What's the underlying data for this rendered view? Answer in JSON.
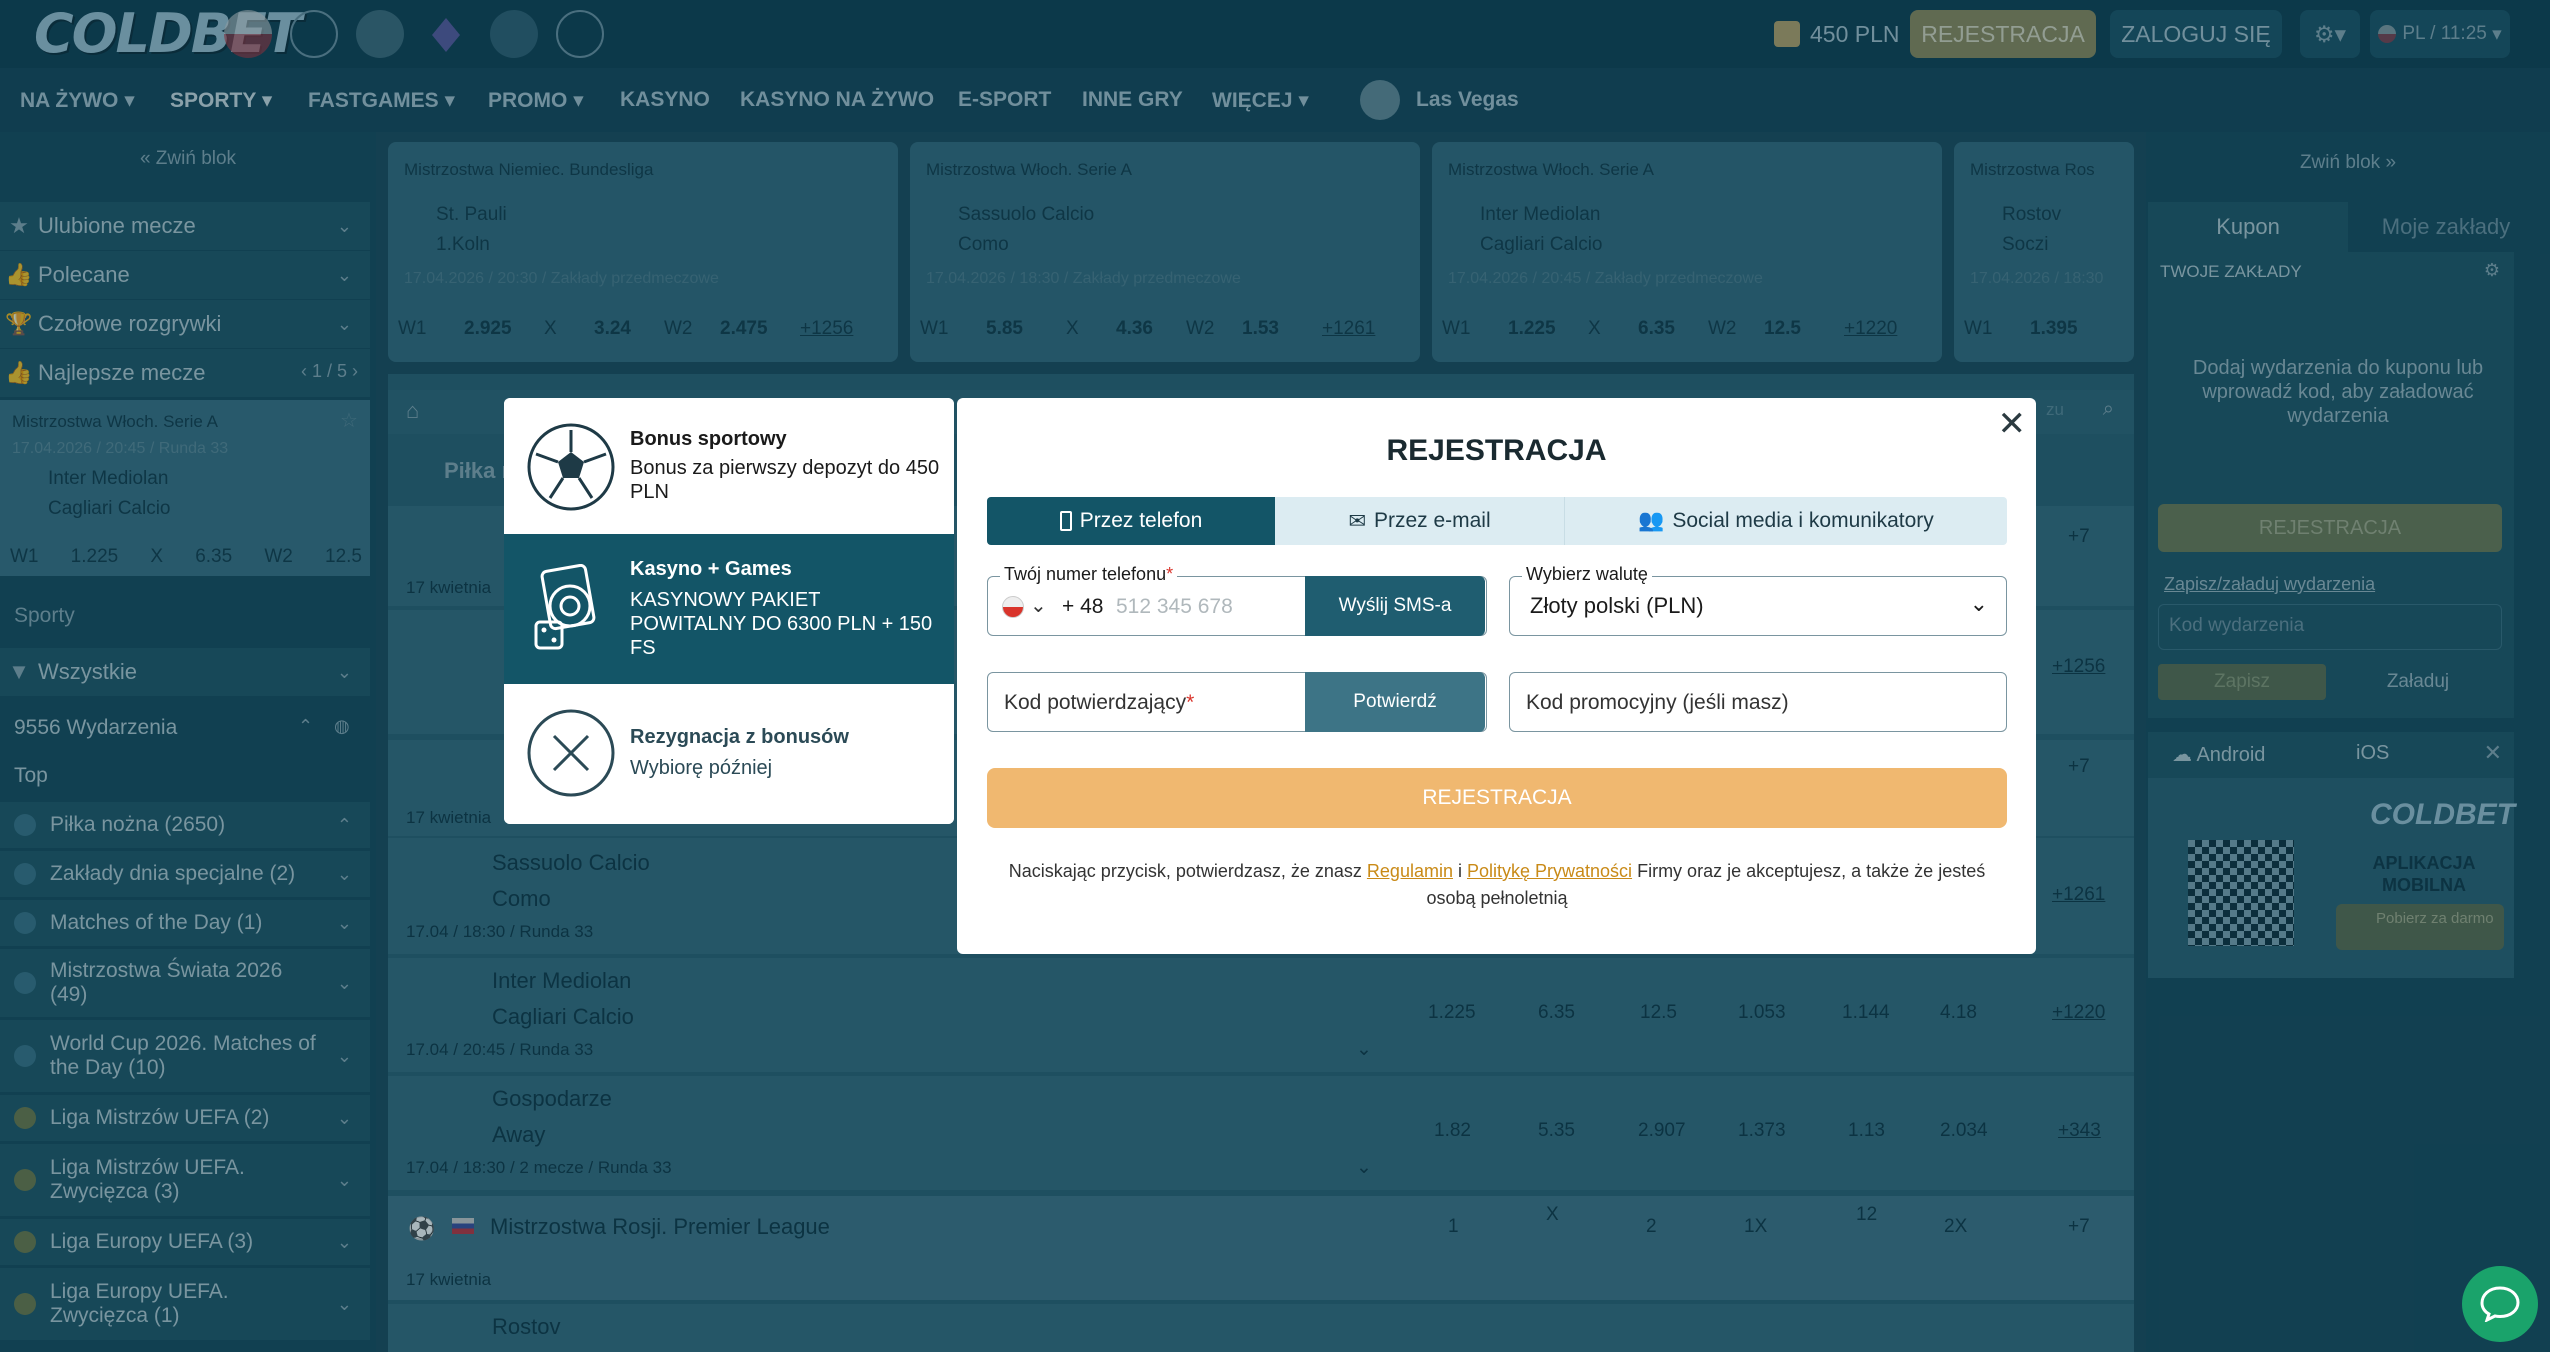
{
  "header": {
    "brand": "COLDBET",
    "balance": "450 PLN",
    "register": "REJESTRACJA",
    "login": "ZALOGUJ SIĘ",
    "lang_time": "PL / 11:25"
  },
  "nav": [
    "NA ŻYWO",
    "SPORTY",
    "FASTGAMES",
    "PROMO",
    "KASYNO",
    "KASYNO NA ŻYWO",
    "E-SPORT",
    "INNE GRY",
    "WIĘCEJ",
    "Las Vegas"
  ],
  "left": {
    "collapse": "Zwiń blok",
    "items": [
      "Ulubione mecze",
      "Polecane",
      "Czołowe rozgrywki",
      "Najlepsze mecze"
    ],
    "best_pager": "1 / 5",
    "mini": {
      "league": "Mistrzostwa Włoch. Serie A",
      "date": "17.04.2026 / 20:45 / Runda 33",
      "home": "Inter Mediolan",
      "away": "Cagliari Calcio",
      "w1": "W1",
      "o1": "1.225",
      "x": "X",
      "ox": "6.35",
      "w2": "W2",
      "o2": "12.5"
    },
    "sports_title": "Sporty",
    "filter": "Wszystkie",
    "events_count": "9556 Wydarzenia",
    "top": "Top",
    "sports": [
      "Piłka nożna (2650)",
      "Zakłady dnia specjalne (2)",
      "Matches of the Day (1)",
      "Mistrzostwa Świata 2026 (49)",
      "World Cup 2026. Matches of the Day (10)",
      "Liga Mistrzów UEFA (2)",
      "Liga Mistrzów UEFA. Zwycięzca (3)",
      "Liga Europy UEFA (3)",
      "Liga Europy UEFA. Zwycięzca (1)"
    ]
  },
  "cards": [
    {
      "league": "Mistrzostwa Niemiec. Bundesliga",
      "home": "St. Pauli",
      "away": "1.Koln",
      "date": "17.04.2026 / 20:30 / Zakłady przedmeczowe",
      "w1": "2.925",
      "x": "3.24",
      "w2": "2.475",
      "more": "+1256"
    },
    {
      "league": "Mistrzostwa Włoch. Serie A",
      "home": "Sassuolo Calcio",
      "away": "Como",
      "date": "17.04.2026 / 18:30 / Zakłady przedmeczowe",
      "w1": "5.85",
      "x": "4.36",
      "w2": "1.53",
      "more": "+1261"
    },
    {
      "league": "Mistrzostwa Włoch. Serie A",
      "home": "Inter Mediolan",
      "away": "Cagliari Calcio",
      "date": "17.04.2026 / 20:45 / Zakłady przedmeczowe",
      "w1": "1.225",
      "x": "6.35",
      "w2": "12.5",
      "more": "+1220"
    },
    {
      "league": "Mistrzostwa Ros",
      "home": "Rostov",
      "away": "Soczi",
      "date": "17.04.2026 / 18:30",
      "w1": "1.395",
      "x": "",
      "w2": "",
      "more": ""
    }
  ],
  "odd_labels": {
    "w1": "W1",
    "x": "X",
    "w2": "W2"
  },
  "center": {
    "league_head": "Piłka n",
    "day1": "17 kwietnia",
    "day2": "17 kwietnia",
    "ev1": {
      "home": "Sassuolo Calcio",
      "away": "Como",
      "date": "17.04 / 18:30 / Runda 33",
      "more": "+1261"
    },
    "ev2": {
      "home": "Inter Mediolan",
      "away": "Cagliari Calcio",
      "date": "17.04 / 20:45 / Runda 33",
      "odds": [
        "1.225",
        "6.35",
        "12.5",
        "1.053",
        "1.144",
        "4.18"
      ],
      "more": "+1220"
    },
    "ev3": {
      "home": "Gospodarze",
      "away": "Away",
      "date": "17.04 / 18:30 / 2 mecze / Runda 33",
      "odds": [
        "1.82",
        "5.35",
        "2.907",
        "1.373",
        "1.13",
        "2.034"
      ],
      "more": "+343"
    },
    "russia": {
      "league": "Mistrzostwa Rosji. Premier League",
      "cols": [
        "1",
        "X",
        "2",
        "1X",
        "12",
        "2X",
        "+7"
      ],
      "day": "17 kwietnia",
      "team": "Rostov"
    },
    "more_top": "+7",
    "more_mid": "+7",
    "more_1256": "+1256",
    "search_hint": "zu"
  },
  "right": {
    "collapse": "Zwiń blok",
    "tab_coupon": "Kupon",
    "tab_bets": "Moje zakłady",
    "your_bets": "TWOJE ZAKŁADY",
    "empty": "Dodaj wydarzenia do kuponu lub wprowadź kod, aby załadować wydarzenia",
    "register": "REJESTRACJA",
    "save_load": "Zapisz/załaduj wydarzenia",
    "code_placeholder": "Kod wydarzenia",
    "save": "Zapisz",
    "load": "Załaduj",
    "android": "Android",
    "ios": "iOS",
    "app_brand": "COLDBET",
    "app_title": "APLIKACJA MOBILNA",
    "download": "Pobierz za darmo"
  },
  "bonus": [
    {
      "title": "Bonus sportowy",
      "desc": "Bonus za pierwszy depozyt do 450 PLN"
    },
    {
      "title": "Kasyno + Games",
      "desc": "KASYNOWY PAKIET POWITALNY DO 6300 PLN + 150 FS"
    },
    {
      "title": "Rezygnacja z bonusów",
      "desc": "Wybiorę później"
    }
  ],
  "modal": {
    "title": "REJESTRACJA",
    "tabs": [
      "Przez telefon",
      "Przez e-mail",
      "Social media i komunikatory"
    ],
    "phone_label": "Twój numer telefonu",
    "phone_prefix": "+ 48",
    "phone_placeholder": "512 345 678",
    "send_sms": "Wyślij SMS-a",
    "currency_label": "Wybierz walutę",
    "currency_value": "Złoty polski (PLN)",
    "code_label": "Kod potwierdzający",
    "confirm": "Potwierdź",
    "promo_placeholder": "Kod promocyjny (jeśli masz)",
    "register": "REJESTRACJA",
    "terms_1": "Naciskając przycisk, potwierdzasz, że znasz",
    "terms_link1": "Regulamin",
    "terms_and": "i",
    "terms_link2": "Politykę Prywatności",
    "terms_2": "Firmy oraz je akceptujesz, a także że jesteś osobą pełnoletnią"
  },
  "colors": {
    "accent": "#f0b870",
    "dark": "#1f5d70",
    "selected": "#135567"
  }
}
